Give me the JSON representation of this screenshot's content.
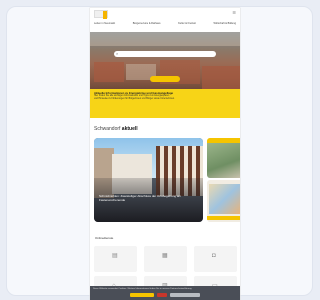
{
  "header": {
    "icon": "menu-icon",
    "nav": [
      "Leben in Neumarkt",
      "Bürgerservice & Rathaus",
      "Kultur & Freizeit",
      "Wirtschaft & Bildung"
    ]
  },
  "hero": {
    "search_placeholder": "",
    "button_label": ""
  },
  "notice": {
    "title": "Aktuelle Informationen zu Energiekrise und Gasmangellage",
    "lines": [
      "Hier finden Sie alle wichtigen Informationen und Tipps zum Energiesparen",
      "und Hinweise zu Förderungen für Bürgerinnen und Bürger sowie Unternehmen."
    ]
  },
  "aktuell": {
    "prefix": "Schwandorf",
    "highlight": "aktuell"
  },
  "news": {
    "main_caption": "Schmidmühlen: Zweistufiger Abschluss der Ortsbegehung am Fastenwochenende"
  },
  "services": {
    "title": "Onlinedienste",
    "tiles": [
      {
        "icon": "document-icon",
        "label": ""
      },
      {
        "icon": "calendar-icon",
        "label": ""
      },
      {
        "icon": "car-icon",
        "label": ""
      },
      {
        "icon": "house-icon",
        "label": ""
      },
      {
        "icon": "book-icon",
        "label": ""
      },
      {
        "icon": "folder-icon",
        "label": ""
      }
    ]
  },
  "cookie": {
    "text": "Diese Website verwendet Cookies. Weitere Informationen finden Sie in unserer Datenschutzerklärung."
  },
  "colors": {
    "accent": "#f5c400",
    "notice_bg": "#f7d417",
    "cookie_bg": "#4a4e57"
  }
}
